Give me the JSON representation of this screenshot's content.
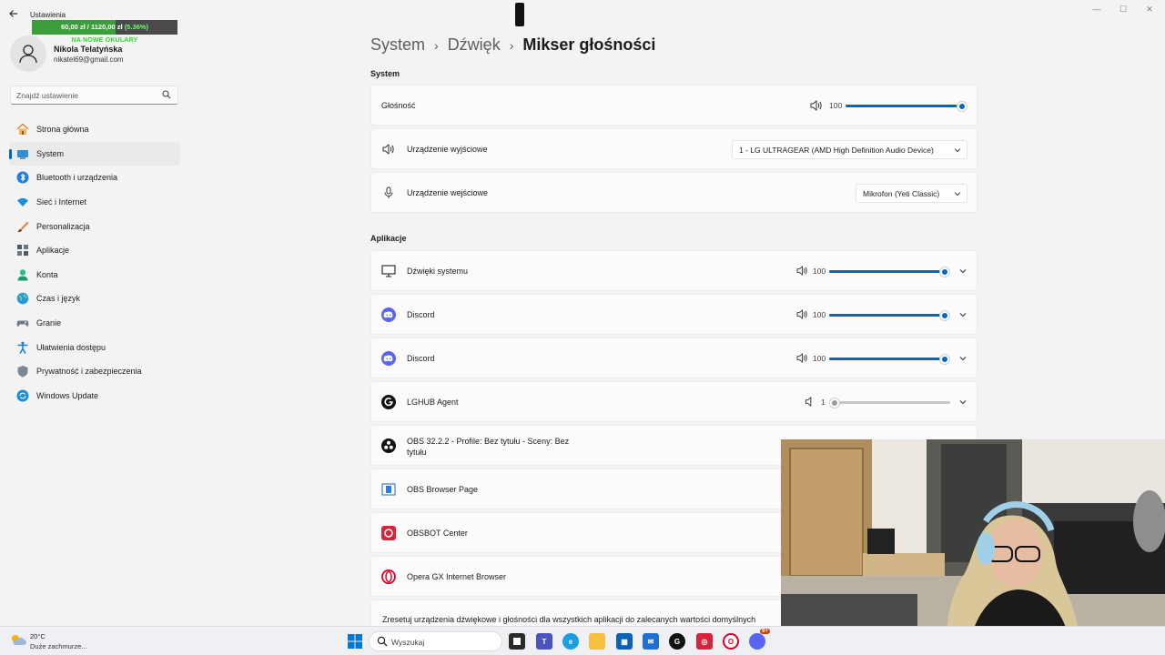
{
  "window": {
    "app_title": "Ustawienia",
    "minimize": "—",
    "maximize": "☐",
    "close": "✕"
  },
  "goal_widget": {
    "amount": "60,00 zł / 1120,00 zł",
    "percent": "(5.36%)",
    "progress": 0.0536,
    "label": "NA NOWE OKULARY"
  },
  "profile": {
    "name": "Nikola Telatyńska",
    "email": "nikatel69@gmail.com"
  },
  "search": {
    "placeholder": "Znajdź ustawienie"
  },
  "sidebar": {
    "items": [
      {
        "label": "Strona główna",
        "icon": "home-icon"
      },
      {
        "label": "System",
        "icon": "system-icon",
        "active": true
      },
      {
        "label": "Bluetooth i urządzenia",
        "icon": "bluetooth-icon"
      },
      {
        "label": "Sieć i Internet",
        "icon": "wifi-icon"
      },
      {
        "label": "Personalizacja",
        "icon": "brush-icon"
      },
      {
        "label": "Aplikacje",
        "icon": "apps-icon"
      },
      {
        "label": "Konta",
        "icon": "account-icon"
      },
      {
        "label": "Czas i język",
        "icon": "globe-icon"
      },
      {
        "label": "Granie",
        "icon": "gamepad-icon"
      },
      {
        "label": "Ułatwienia dostępu",
        "icon": "accessibility-icon"
      },
      {
        "label": "Prywatność i zabezpieczenia",
        "icon": "shield-icon"
      },
      {
        "label": "Windows Update",
        "icon": "update-icon"
      }
    ]
  },
  "breadcrumb": {
    "level1": "System",
    "level2": "Dźwięk",
    "current": "Mikser głośności",
    "separator": "›"
  },
  "system_section": {
    "title": "System",
    "volume": {
      "label": "Głośność",
      "value": "100",
      "level": 1.0
    },
    "output": {
      "label": "Urządzenie wyjściowe",
      "selected": "1 - LG ULTRAGEAR (AMD High Definition Audio Device)"
    },
    "input": {
      "label": "Urządzenie wejściowe",
      "selected": "Mikrofon (Yeti Classic)"
    }
  },
  "apps_section": {
    "title": "Aplikacje",
    "apps": [
      {
        "name": "Dźwięki systemu",
        "value": "100",
        "level": 1.0,
        "icon": "monitor-icon"
      },
      {
        "name": "Discord",
        "value": "100",
        "level": 1.0,
        "icon": "discord-icon"
      },
      {
        "name": "Discord",
        "value": "100",
        "level": 1.0,
        "icon": "discord-icon"
      },
      {
        "name": "LGHUB Agent",
        "value": "1",
        "level": 0.01,
        "icon": "logitech-icon"
      },
      {
        "name": "OBS 32.2.2 - Profile: Bez tytułu - Sceny: Bez tytułu",
        "icon": "obs-icon"
      },
      {
        "name": "OBS Browser Page",
        "icon": "browser-page-icon"
      },
      {
        "name": "OBSBOT Center",
        "icon": "obsbot-icon"
      },
      {
        "name": "Opera GX Internet Browser",
        "icon": "opera-icon"
      }
    ],
    "reset_text": "Zresetuj urządzenia dźwiękowe i głośności dla wszystkich aplikacji do zalecanych wartości domyślnych"
  },
  "taskbar": {
    "weather_temp": "20°C",
    "weather_desc": "Duże zachmurze...",
    "search_placeholder": "Wyszukaj",
    "discord_badge": "9+"
  },
  "colors": {
    "accent": "#0067c0",
    "goal_green": "#32d632",
    "discord": "#5865f2",
    "opera": "#e0002a"
  }
}
